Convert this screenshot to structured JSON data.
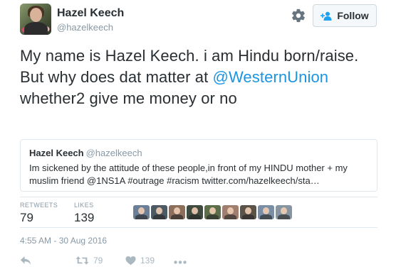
{
  "user": {
    "display_name": "Hazel Keech",
    "handle": "@hazelkeech"
  },
  "header": {
    "settings_icon": "gear-icon",
    "follow_icon": "person-add-icon",
    "follow_label": "Follow"
  },
  "tweet": {
    "text_before_mention": "My name is Hazel Keech. i am Hindu born/raise. But why does dat matter at ",
    "mention": "@WesternUnion",
    "text_after_mention": " whether2 give me money or no"
  },
  "quoted_tweet": {
    "display_name": "Hazel Keech",
    "handle": "@hazelkeech",
    "text": "Im sickened by the attitude of these people,in front of my HINDU mother + my muslim friend @1NS1A #outrage #racism  twitter.com/hazelkeech/sta…"
  },
  "stats": {
    "retweets_label": "RETWEETS",
    "retweets": "79",
    "likes_label": "LIKES",
    "likes": "139"
  },
  "likers_count_shown": 9,
  "timestamp": "4:55 AM - 30 Aug 2016",
  "actions": {
    "reply_icon": "reply-icon",
    "retweet_icon": "retweet-icon",
    "retweet_count": "79",
    "like_icon": "heart-icon",
    "like_count": "139",
    "more_icon": "more-dots-icon"
  },
  "colors": {
    "link": "#1b95e0",
    "muted": "#8899a6",
    "text": "#292f33",
    "border": "#e1e8ed"
  }
}
